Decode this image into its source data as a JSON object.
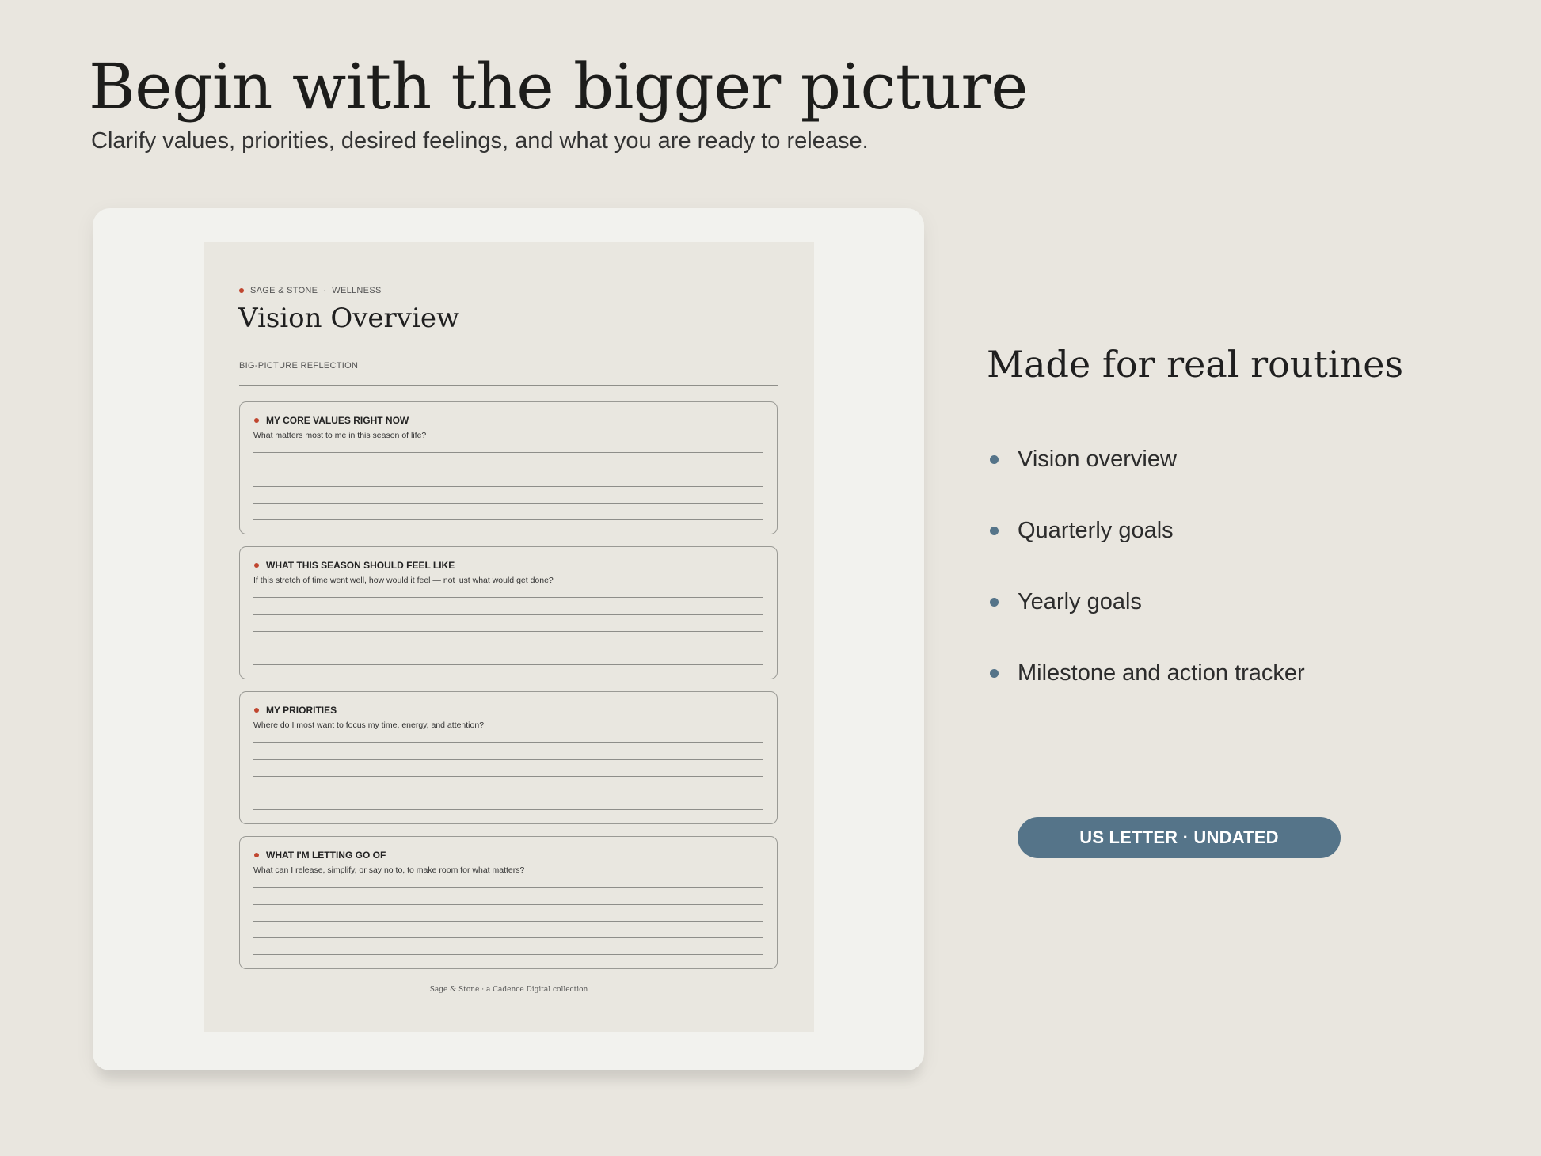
{
  "hero": {
    "title": "Begin with the bigger picture",
    "subtitle": "Clarify values, priorities, desired feelings, and what you are ready to release."
  },
  "sheet": {
    "brand": "SAGE & STONE",
    "brand_separator": "·",
    "category": "WELLNESS",
    "title": "Vision Overview",
    "kicker": "BIG-PICTURE REFLECTION",
    "prompts": [
      {
        "heading": "MY CORE VALUES RIGHT NOW",
        "question": "What matters most to me in this season of life?"
      },
      {
        "heading": "WHAT THIS SEASON SHOULD FEEL LIKE",
        "question": "If this stretch of time went well, how would it feel — not just what would get done?"
      },
      {
        "heading": "MY PRIORITIES",
        "question": "Where do I most want to focus my time, energy, and attention?"
      },
      {
        "heading": "WHAT I'M LETTING GO OF",
        "question": "What can I release, simplify, or say no to, to make room for what matters?"
      }
    ],
    "footer": "Sage & Stone  ·  a Cadence Digital collection"
  },
  "features": {
    "title": "Made for real routines",
    "items": [
      "Vision overview",
      "Quarterly goals",
      "Yearly goals",
      "Milestone and action tracker"
    ]
  },
  "format_badge": "US LETTER · UNDATED",
  "colors": {
    "background": "#e9e6df",
    "accent_blue": "#557489",
    "accent_red": "#c0462f",
    "card": "#f2f2ee",
    "sheet": "#e9e7e0"
  }
}
